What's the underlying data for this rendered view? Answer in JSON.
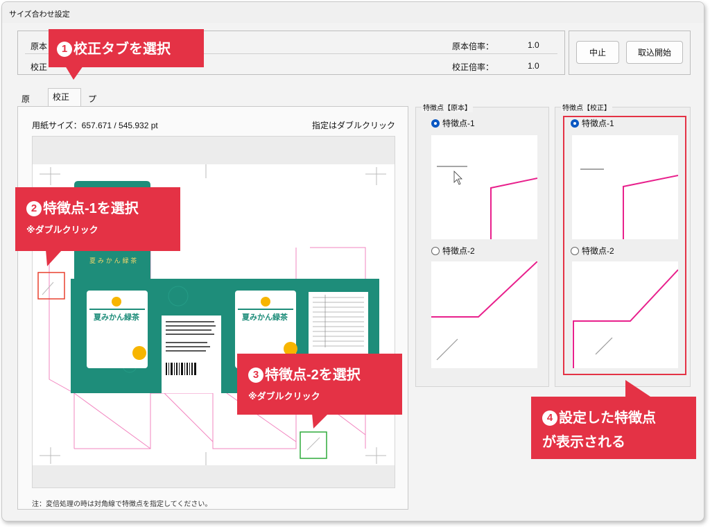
{
  "window": {
    "title": "サイズ合わせ設定"
  },
  "info": {
    "original_label": "原本",
    "calib_label": "校正",
    "original_scale_label": "原本倍率：",
    "original_scale_value": "1.0",
    "calib_scale_label": "校正倍率：",
    "calib_scale_value": "1.0"
  },
  "buttons": {
    "cancel": "中止",
    "start": "取込開始"
  },
  "tabs": [
    {
      "label": "原本",
      "active": false
    },
    {
      "label": "校正",
      "active": true
    },
    {
      "label": "プレビュー",
      "active": false
    }
  ],
  "preview": {
    "paper_size": "用紙サイズ：657.671 / 545.932 pt",
    "double_click_hint": "指定はダブルクリック",
    "note": "注：変倍処理の時は対角線で特徴点を指定してください。",
    "product_name": "夏みかん緑茶"
  },
  "feature_original": {
    "legend": "特徴点【原本】",
    "point1": "特徴点-1",
    "point2": "特徴点-2",
    "selected": "point1"
  },
  "feature_calib": {
    "legend": "特徴点【校正】",
    "point1": "特徴点-1",
    "point2": "特徴点-2",
    "selected": "point1"
  },
  "callouts": {
    "c1": {
      "num": "1",
      "text": "校正タブを選択"
    },
    "c2": {
      "num": "2",
      "text": "特徴点-1を選択",
      "sub": "※ダブルクリック"
    },
    "c3": {
      "num": "3",
      "text": "特徴点-2を選択",
      "sub": "※ダブルクリック"
    },
    "c4": {
      "num": "4",
      "line1": "設定した特徴点",
      "line2": "が表示される"
    }
  },
  "colors": {
    "accent": "#e43245",
    "teal": "#1e8d7a",
    "magenta": "#e8208c",
    "radio_blue": "#0a57c2",
    "marker_red": "#e8402f",
    "marker_green": "#2eaa3a"
  }
}
